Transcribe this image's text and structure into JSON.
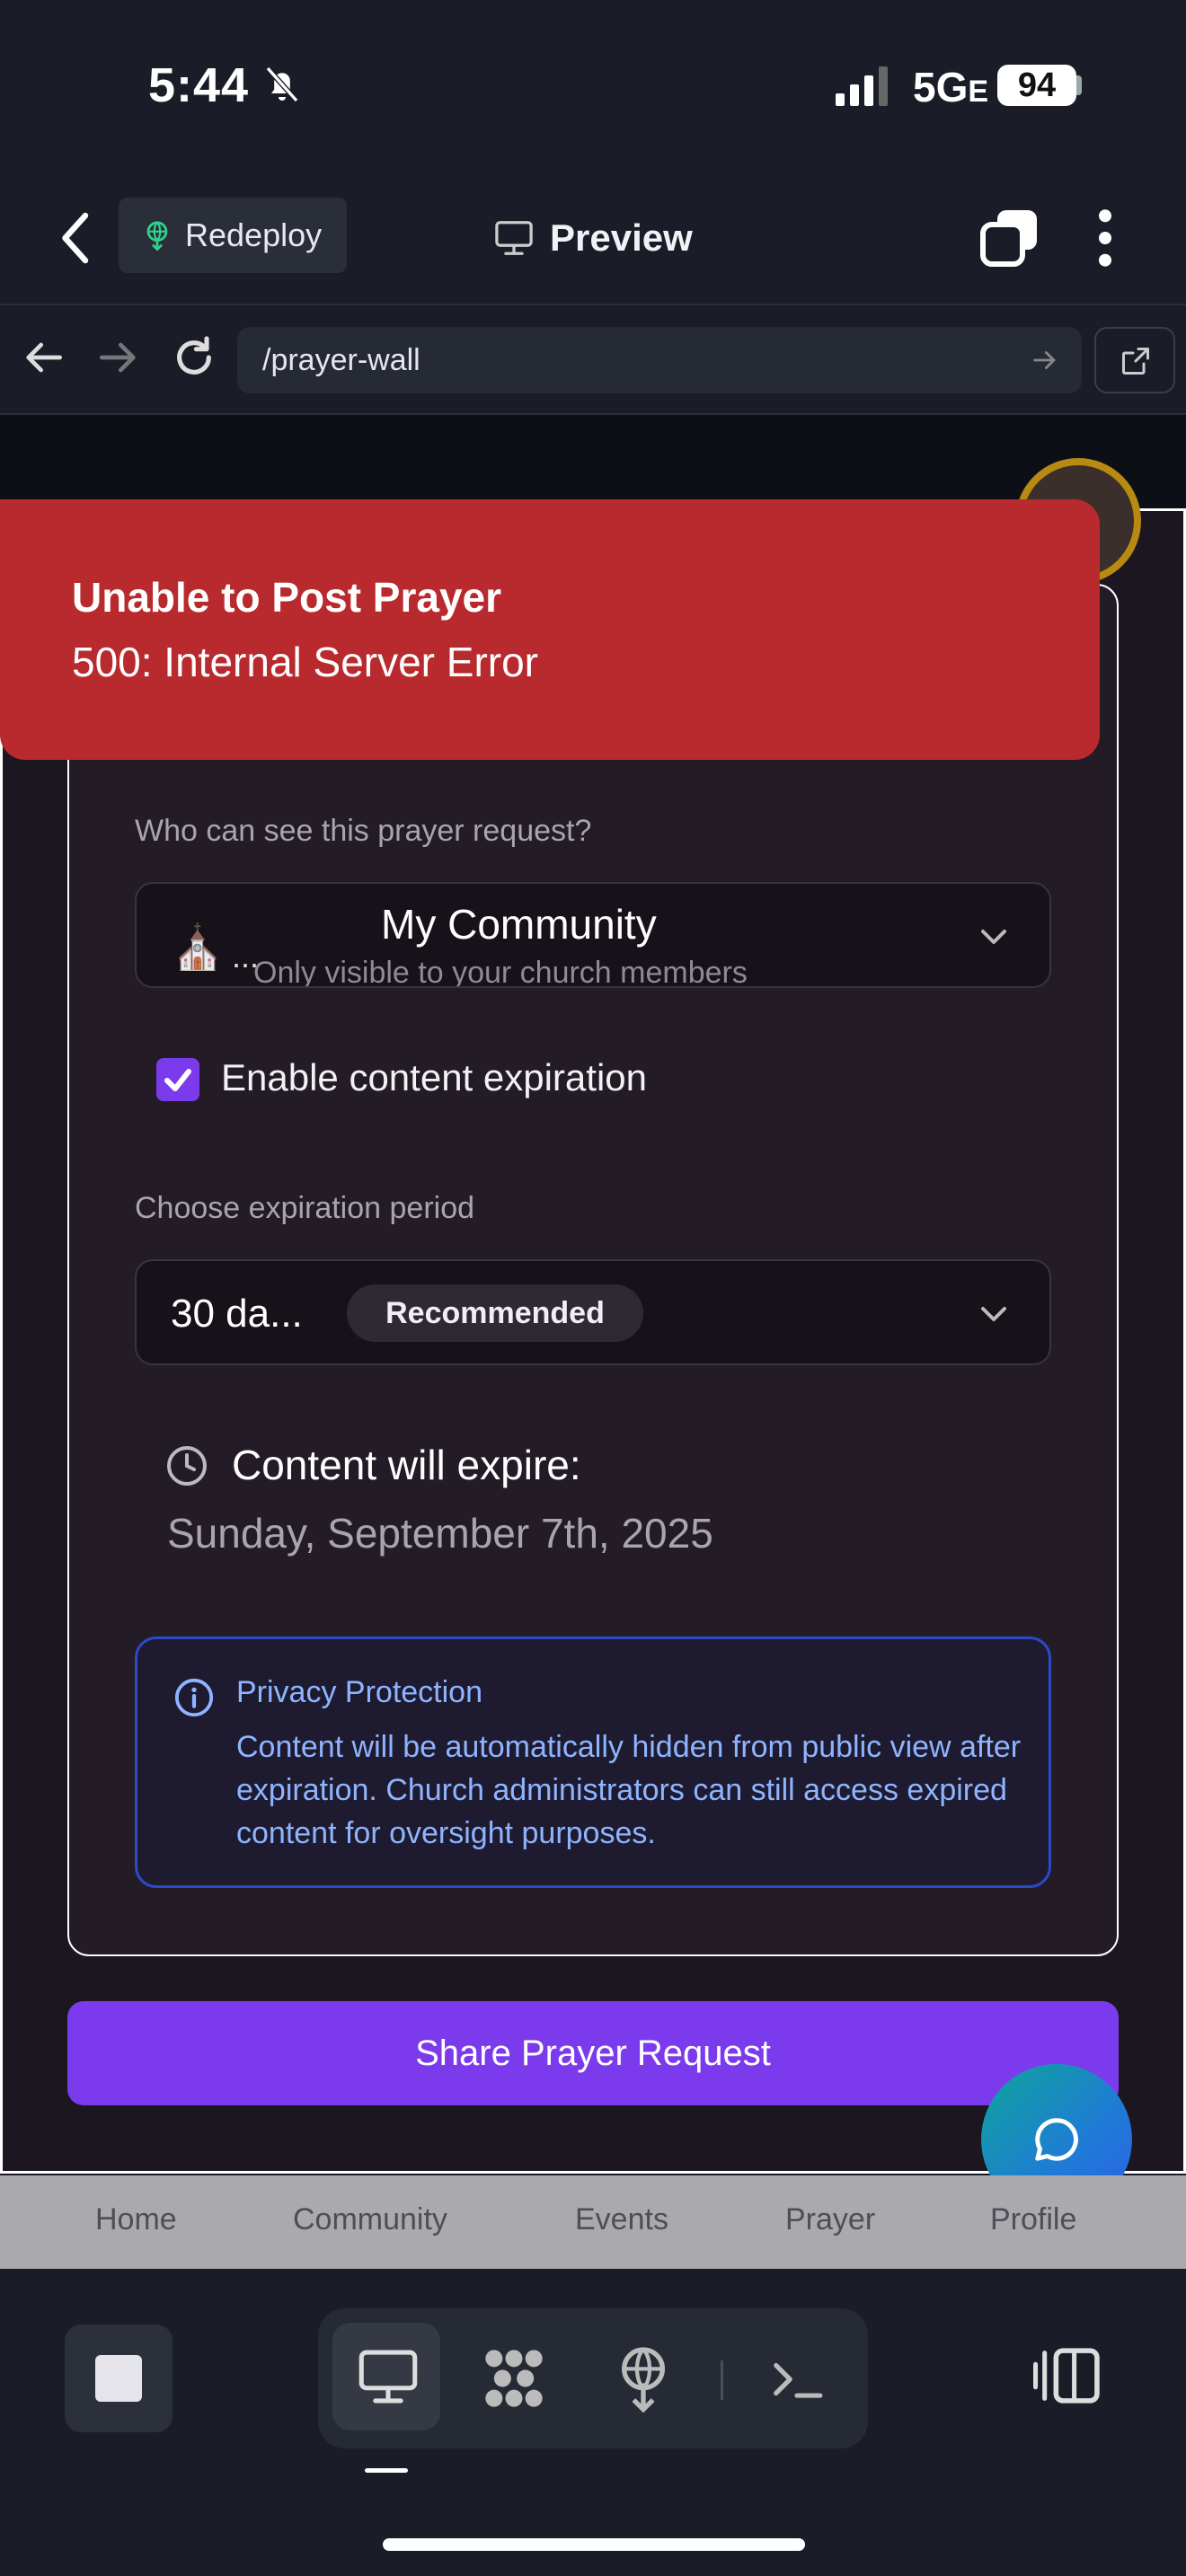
{
  "status_bar": {
    "time": "5:44",
    "network": "5G",
    "network_suffix": "E",
    "battery": "94"
  },
  "app_bar": {
    "redeploy_label": "Redeploy",
    "preview_label": "Preview"
  },
  "browser": {
    "url": "/prayer-wall"
  },
  "toast": {
    "title": "Unable to Post Prayer",
    "message": "500: Internal Server Error"
  },
  "form": {
    "visibility_label": "Who can see this prayer request?",
    "visibility_value": "My Community",
    "visibility_desc": "Only visible to your church members",
    "visibility_icon": "church-icon",
    "visibility_ellipsis": "...",
    "expiration_checkbox_label": "Enable content expiration",
    "expiration_checked": true,
    "period_label": "Choose expiration period",
    "period_value": "30 da...",
    "period_badge": "Recommended",
    "expire_title": "Content will expire:",
    "expire_date": "Sunday, September 7th, 2025",
    "privacy_title": "Privacy Protection",
    "privacy_body": "Content will be automatically hidden from public view after expiration. Church administrators can still access expired content for oversight purposes.",
    "submit_label": "Share Prayer Request"
  },
  "web_nav": {
    "items": [
      "Home",
      "Community",
      "Events",
      "Prayer",
      "Profile"
    ]
  },
  "colors": {
    "accent": "#7c3aed",
    "error": "#b92a2e",
    "info": "#8fb4ff"
  }
}
